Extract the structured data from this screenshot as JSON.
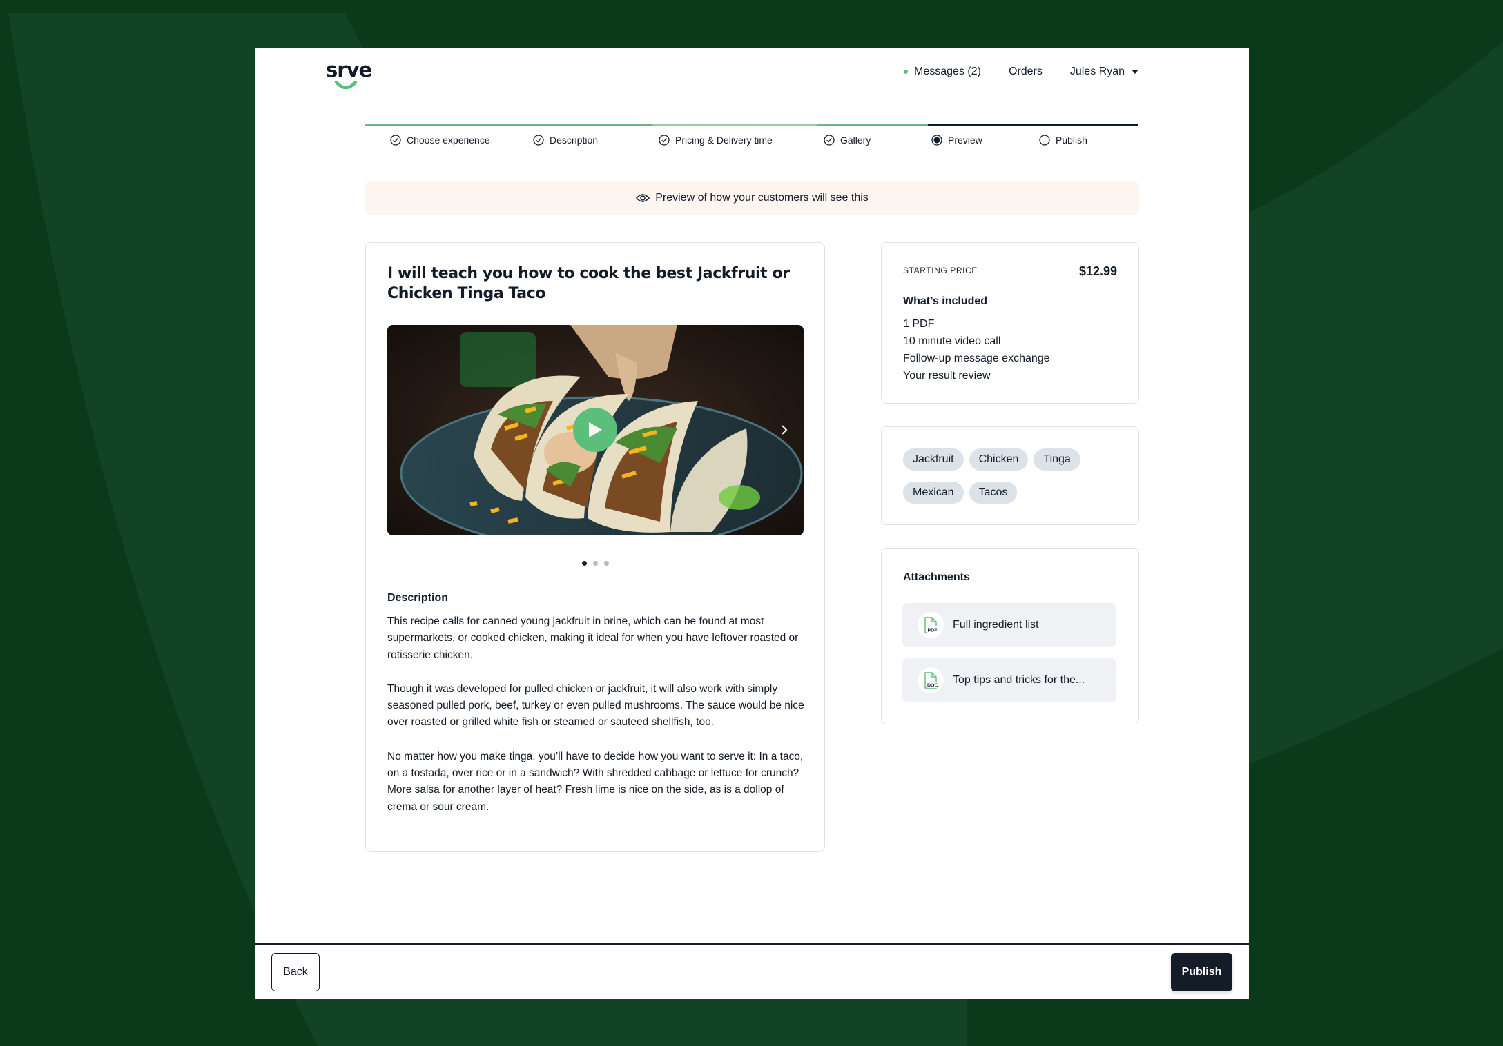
{
  "brand": {
    "logo_text": "srve",
    "accent": "#5bbf7b",
    "dark": "#121b27",
    "background": "#0b3a1b"
  },
  "header": {
    "messages_label": "Messages (2)",
    "orders_label": "Orders",
    "user_name": "Jules Ryan"
  },
  "stepper": {
    "steps": [
      {
        "label": "Choose experience",
        "state": "complete"
      },
      {
        "label": "Description",
        "state": "complete"
      },
      {
        "label": "Pricing & Delivery time",
        "state": "complete"
      },
      {
        "label": "Gallery",
        "state": "complete"
      },
      {
        "label": "Preview",
        "state": "current"
      },
      {
        "label": "Publish",
        "state": "pending"
      }
    ]
  },
  "banner": {
    "icon": "eye-icon",
    "text": "Preview of how your customers will see this"
  },
  "listing": {
    "title": "I will teach you how to cook the best Jackfruit or Chicken Tinga Taco",
    "media": {
      "type": "video",
      "alt": "Tacos with sauce being poured",
      "slide_count": 3,
      "active_slide": 1
    },
    "description_heading": "Description",
    "description_paragraphs": [
      "This recipe calls for canned young jackfruit in brine, which can be found at most supermarkets, or cooked chicken, making it ideal for when you have leftover roasted or rotisserie chicken.",
      "Though it was developed for pulled chicken or jackfruit, it will also work with simply seasoned pulled pork, beef, turkey or even pulled mushrooms. The sauce would be nice over roasted or grilled white fish or steamed or sauteed shellfish, too.",
      "No matter how you make tinga, you’ll have to decide how you want to serve it: In a taco, on a tostada, over rice or in a sandwich? With shredded cabbage or lettuce for crunch? More salsa for another layer of heat? Fresh lime is nice on the side, as is a dollop of crema or sour cream."
    ]
  },
  "pricing": {
    "label": "STARTING PRICE",
    "price": "$12.99",
    "included_heading": "What’s included",
    "included": [
      "1 PDF",
      "10 minute video call",
      "Follow-up message exchange",
      "Your result review"
    ]
  },
  "tags": [
    "Jackfruit",
    "Chicken",
    "Tinga",
    "Mexican",
    "Tacos"
  ],
  "attachments": {
    "heading": "Attachments",
    "items": [
      {
        "name": "Full ingredient list",
        "type": "PDF"
      },
      {
        "name": "Top tips and tricks for the...",
        "type": "DOC"
      }
    ]
  },
  "footer": {
    "back_label": "Back",
    "publish_label": "Publish"
  }
}
